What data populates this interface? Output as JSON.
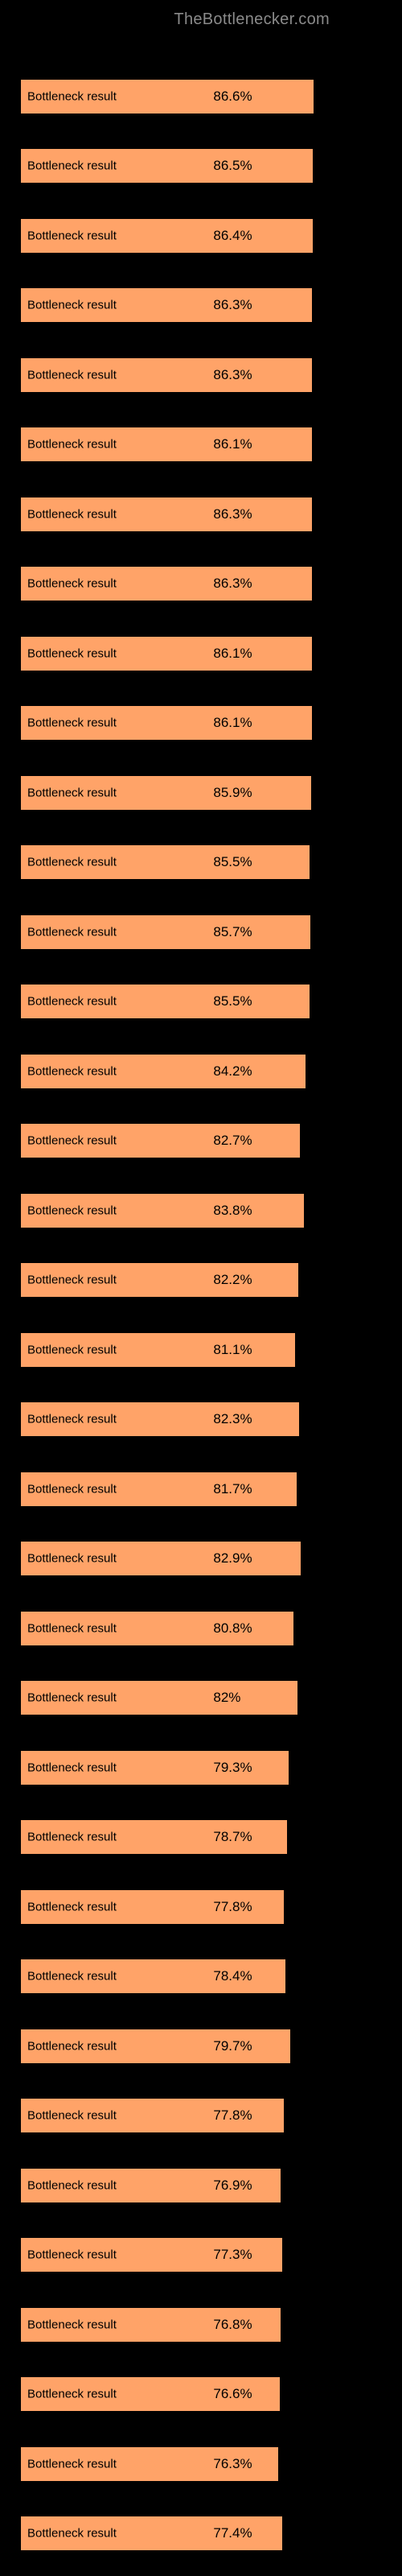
{
  "header": {
    "brand": "TheBottlenecker.com"
  },
  "chart_data": {
    "type": "bar",
    "title": "",
    "xlabel": "",
    "ylabel": "",
    "xlim": [
      0,
      100
    ],
    "bar_color": "#ffa368",
    "bar_label": "Bottleneck result",
    "items": [
      {
        "value": 86.6,
        "display": "86.6%"
      },
      {
        "value": 86.5,
        "display": "86.5%"
      },
      {
        "value": 86.4,
        "display": "86.4%"
      },
      {
        "value": 86.3,
        "display": "86.3%"
      },
      {
        "value": 86.3,
        "display": "86.3%"
      },
      {
        "value": 86.1,
        "display": "86.1%"
      },
      {
        "value": 86.3,
        "display": "86.3%"
      },
      {
        "value": 86.3,
        "display": "86.3%"
      },
      {
        "value": 86.1,
        "display": "86.1%"
      },
      {
        "value": 86.1,
        "display": "86.1%"
      },
      {
        "value": 85.9,
        "display": "85.9%"
      },
      {
        "value": 85.5,
        "display": "85.5%"
      },
      {
        "value": 85.7,
        "display": "85.7%"
      },
      {
        "value": 85.5,
        "display": "85.5%"
      },
      {
        "value": 84.2,
        "display": "84.2%"
      },
      {
        "value": 82.7,
        "display": "82.7%"
      },
      {
        "value": 83.8,
        "display": "83.8%"
      },
      {
        "value": 82.2,
        "display": "82.2%"
      },
      {
        "value": 81.1,
        "display": "81.1%"
      },
      {
        "value": 82.3,
        "display": "82.3%"
      },
      {
        "value": 81.7,
        "display": "81.7%"
      },
      {
        "value": 82.9,
        "display": "82.9%"
      },
      {
        "value": 80.8,
        "display": "80.8%"
      },
      {
        "value": 82.0,
        "display": "82%"
      },
      {
        "value": 79.3,
        "display": "79.3%"
      },
      {
        "value": 78.7,
        "display": "78.7%"
      },
      {
        "value": 77.8,
        "display": "77.8%"
      },
      {
        "value": 78.4,
        "display": "78.4%"
      },
      {
        "value": 79.7,
        "display": "79.7%"
      },
      {
        "value": 77.8,
        "display": "77.8%"
      },
      {
        "value": 76.9,
        "display": "76.9%"
      },
      {
        "value": 77.3,
        "display": "77.3%"
      },
      {
        "value": 76.8,
        "display": "76.8%"
      },
      {
        "value": 76.6,
        "display": "76.6%"
      },
      {
        "value": 76.3,
        "display": "76.3%"
      },
      {
        "value": 77.4,
        "display": "77.4%"
      }
    ]
  }
}
